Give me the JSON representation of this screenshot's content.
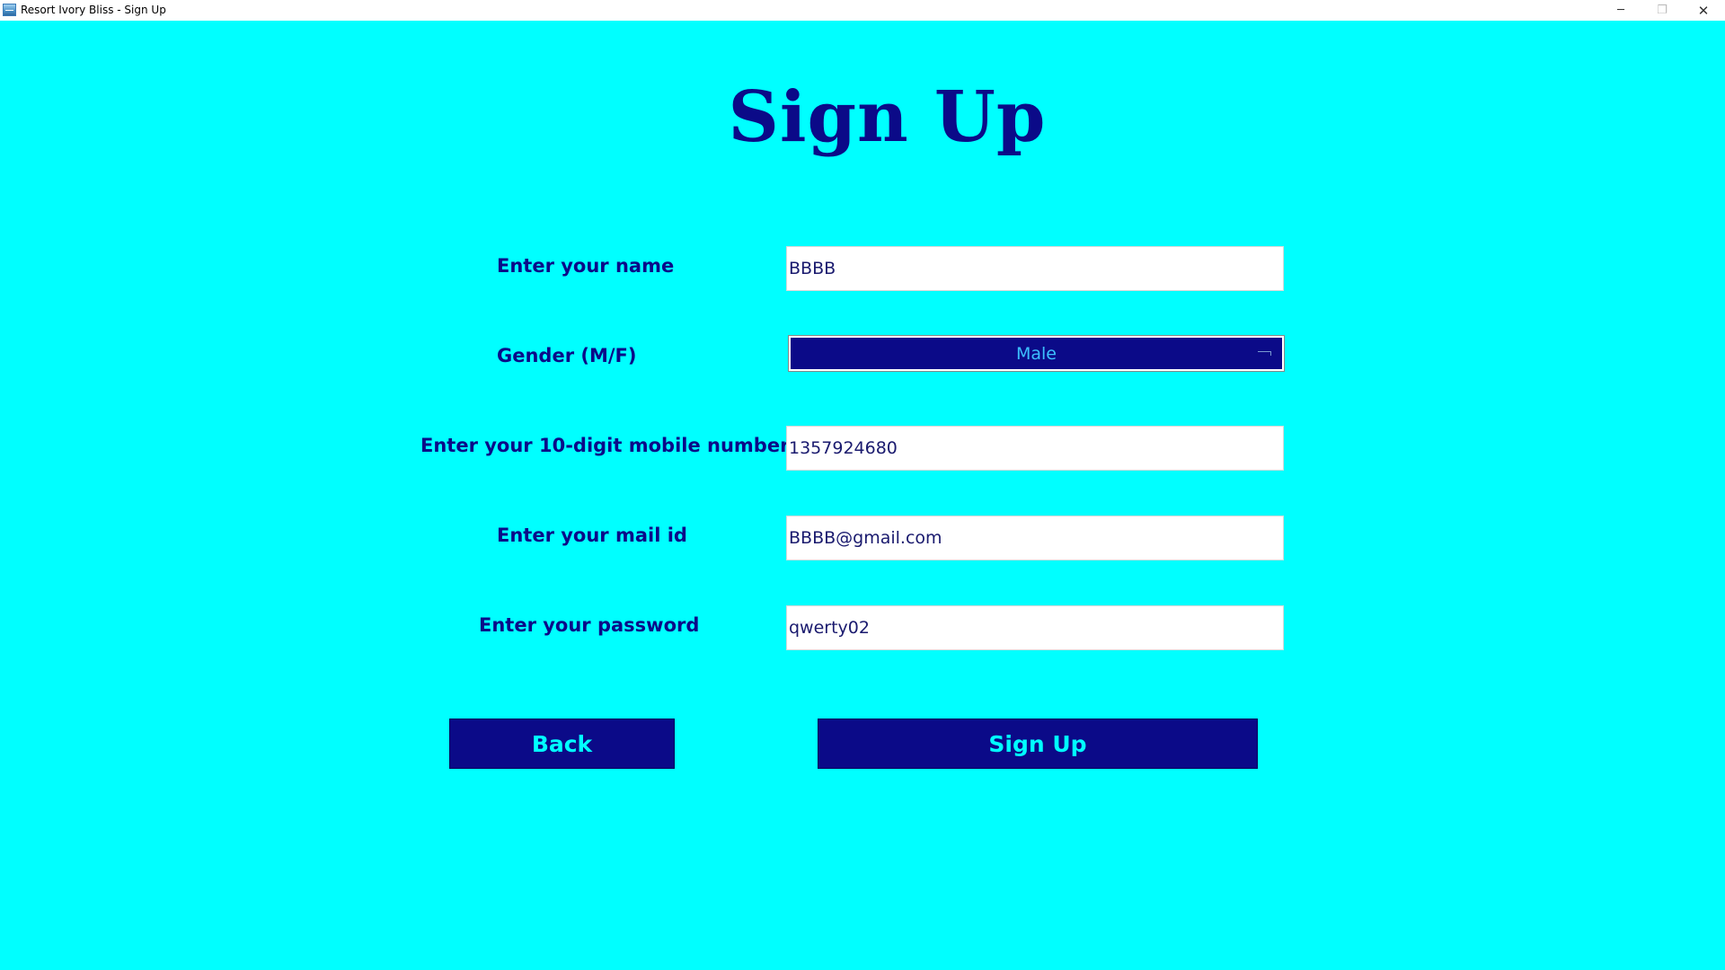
{
  "window": {
    "title": "Resort Ivory Bliss - Sign Up",
    "minimize_glyph": "─",
    "maximize_glyph": "❐",
    "close_glyph": "✕"
  },
  "page": {
    "title": "Sign Up"
  },
  "form": {
    "name": {
      "label": "Enter your name",
      "value": "BBBB"
    },
    "gender": {
      "label": "Gender (M/F)",
      "selected": "Male"
    },
    "mobile": {
      "label": "Enter your 10-digit mobile number",
      "value": "1357924680"
    },
    "email": {
      "label": "Enter your mail id",
      "value": "BBBB@gmail.com"
    },
    "password": {
      "label": "Enter your password",
      "value": "qwerty02"
    }
  },
  "actions": {
    "back_label": "Back",
    "signup_label": "Sign Up"
  },
  "colors": {
    "background": "#00ffff",
    "primary": "#0b0a88",
    "button_text": "#00ffff",
    "select_text": "#3cc0ff"
  },
  "icons": {
    "app": "app-window-icon",
    "select_indicator": "option-menu-indicator-icon"
  }
}
